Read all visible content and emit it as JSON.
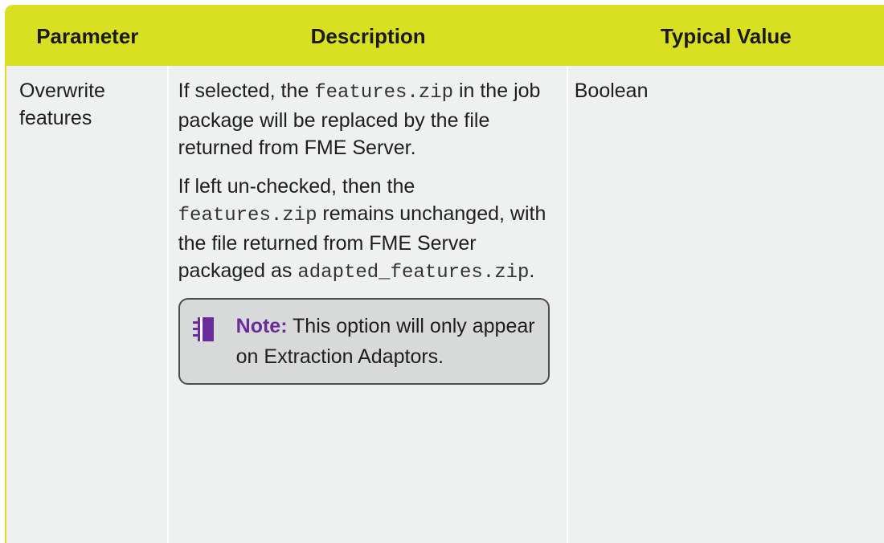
{
  "table": {
    "headers": [
      "Parameter",
      "Description",
      "Typical Value"
    ],
    "row": {
      "parameter": "Overwrite features",
      "desc1_pre": "If selected, the ",
      "desc1_code": "features.zip",
      "desc1_post": " in the job package will be replaced by the file returned from FME Server.",
      "desc2_pre": "If left un-checked, then the ",
      "desc2_code": "features.zip",
      "desc2_mid": " remains unchanged, with the file returned from FME Server packaged as ",
      "desc2_code2": "adapted_features.zip",
      "desc2_post": ".",
      "note_label": "Note:",
      "note_text": " This option will only appear on Extraction Adaptors.",
      "value": "Boolean"
    }
  },
  "colors": {
    "header_bg": "#d9e021",
    "body_bg": "#eef1f0",
    "note_bg": "#d8d9d9",
    "note_accent": "#6a2c9b"
  },
  "icons": {
    "note": "notebook-icon"
  }
}
